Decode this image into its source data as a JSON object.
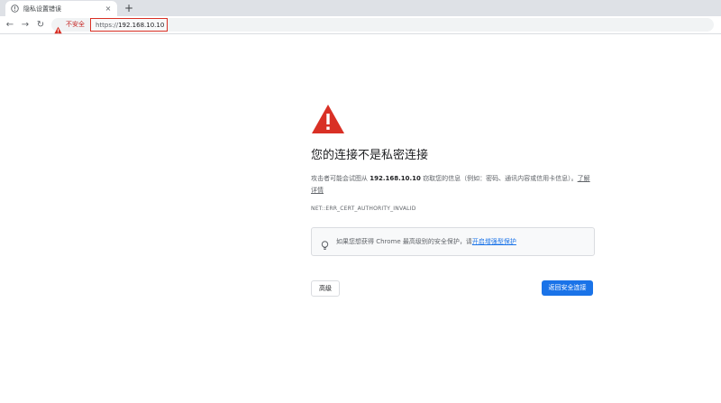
{
  "tab": {
    "title": "隐私设置错误",
    "close_symbol": "×",
    "newtab_symbol": "+"
  },
  "toolbar": {
    "back_symbol": "←",
    "forward_symbol": "→",
    "reload_symbol": "↻",
    "insecure_label": "不安全",
    "url_scheme": "https://",
    "url_host": "192.168.10.10"
  },
  "interstitial": {
    "title": "您的连接不是私密连接",
    "desc_prefix": "攻击者可能会试图从 ",
    "desc_host": "192.168.10.10",
    "desc_middle": " 窃取您的信息（例如：密码、通讯内容或信用卡信息）。",
    "desc_link": "了解详情",
    "error_code": "NET::ERR_CERT_AUTHORITY_INVALID",
    "safe_prefix": "如果您想获得 Chrome 最高级别的安全保护，请",
    "safe_link": "开启增强型保护",
    "advanced_label": "高级",
    "back_label": "返回安全连接"
  },
  "colors": {
    "warning_red": "#d93025",
    "link_blue": "#1a73e8",
    "button_blue": "#1a73e8"
  },
  "icons": {
    "tab_favicon": "warning-circle-icon",
    "omnibox_warning": "warning-triangle-icon",
    "hero": "warning-triangle-icon",
    "safety_hint": "lightbulb-icon"
  }
}
